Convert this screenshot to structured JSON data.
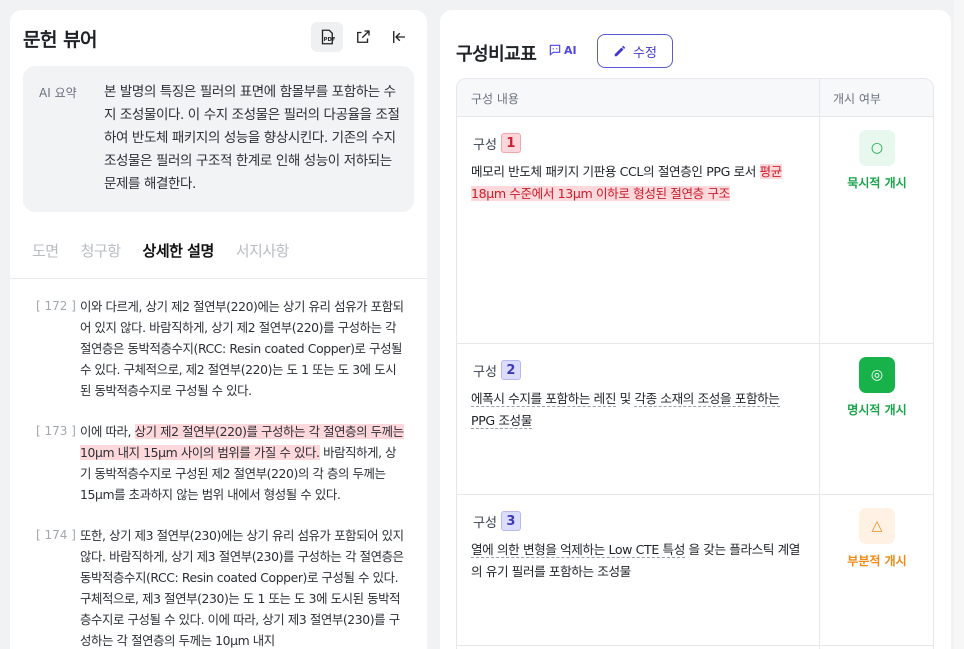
{
  "left": {
    "title": "문헌 뷰어",
    "summary": {
      "label": "AI 요약",
      "text": "본 발명의 특징은 필러의 표면에 함몰부를 포함하는 수지 조성물이다. 이 수지 조성물은 필러의 다공율을 조절하여 반도체 패키지의 성능을 향상시킨다. 기존의 수지 조성물은 필러의 구조적 한계로 인해 성능이 저하되는 문제를 해결한다."
    },
    "tabs": [
      "도면",
      "청구항",
      "상세한 설명",
      "서지사항"
    ],
    "active_tab": "상세한 설명",
    "paragraphs": [
      {
        "num": "[ 172 ]",
        "pre": "이와 다르게, 상기 제2 절연부(220)에는 상기 유리 섬유가 포함되어 있지 않다. 바람직하게, 상기 제2 절연부(220)를 구성하는 각 절연층은 동박적층수지(RCC: Resin coated Copper)로 구성될 수 있다. 구체적으로, 제2 절연부(220)는 도 1 또는 도 3에 도시된 동박적층수지로 구성될 수 있다.",
        "hl": "",
        "post": ""
      },
      {
        "num": "[ 173 ]",
        "pre": "이에 따라, ",
        "hl": "상기 제2 절연부(220)를 구성하는 각 절연층의 두께는 10μm 내지 15μm 사이의 범위를 가질 수 있다.",
        "post": " 바람직하게, 상기 동박적층수지로 구성된 제2 절연부(220)의 각 층의 두께는 15μm를 초과하지 않는 범위 내에서 형성될 수 있다."
      },
      {
        "num": "[ 174 ]",
        "pre": "또한, 상기 제3 절연부(230)에는 상기 유리 섬유가 포함되어 있지 않다. 바람직하게, 상기 제3 절연부(230)를 구성하는 각 절연층은 동박적층수지(RCC: Resin coated Copper)로 구성될 수 있다. 구체적으로, 제3 절연부(230)는 도 1 또는 도 3에 도시된 동박적층수지로 구성될 수 있다. 이에 따라, 상기 제3 절연부(230)를 구성하는 각 절연층의 두께는 10μm 내지",
        "hl": "",
        "post": ""
      }
    ]
  },
  "right": {
    "title": "구성비교표",
    "ai_label": "AI",
    "edit_label": "수정",
    "col_content": "구성 내용",
    "col_status": "개시 여부",
    "rows": [
      {
        "label": "구성",
        "num": "1",
        "a": "메모리 반도체 패키지 기판용 CCL의 절연층인 PPG 로서 ",
        "b": "평균 18μm 수준에서 13μm 이하로 형성된 절연층 구조",
        "c": "",
        "d": "",
        "e": "",
        "status_icon": "○",
        "status": "묵시적 개시",
        "color": "#1aa34a",
        "bg": "#e8f8ee",
        "icon_color": "#1aa34a"
      },
      {
        "label": "구성",
        "num": "2",
        "a": "에폭시 수지를 포함하는 레진",
        "b": " 및 ",
        "c": "각종 소재의 조성을 포함하는 PPG 조성물",
        "d": "",
        "e": "",
        "status_icon": "◎",
        "status": "명시적 개시",
        "color": "#1aa34a",
        "bg": "#17b24a",
        "icon_color": "#ffffff"
      },
      {
        "label": "구성",
        "num": "3",
        "a": "열에 의한 변형을 억제하는 Low CTE 특성",
        "b": " 을 갖는 플라스틱 계열의 유기 필러를 포함하는 조성물",
        "c": "",
        "d": "",
        "e": "",
        "status_icon": "△",
        "status": "부분적 개시",
        "color": "#f08a16",
        "bg": "#fff1e3",
        "icon_color": "#f08a16"
      }
    ]
  }
}
